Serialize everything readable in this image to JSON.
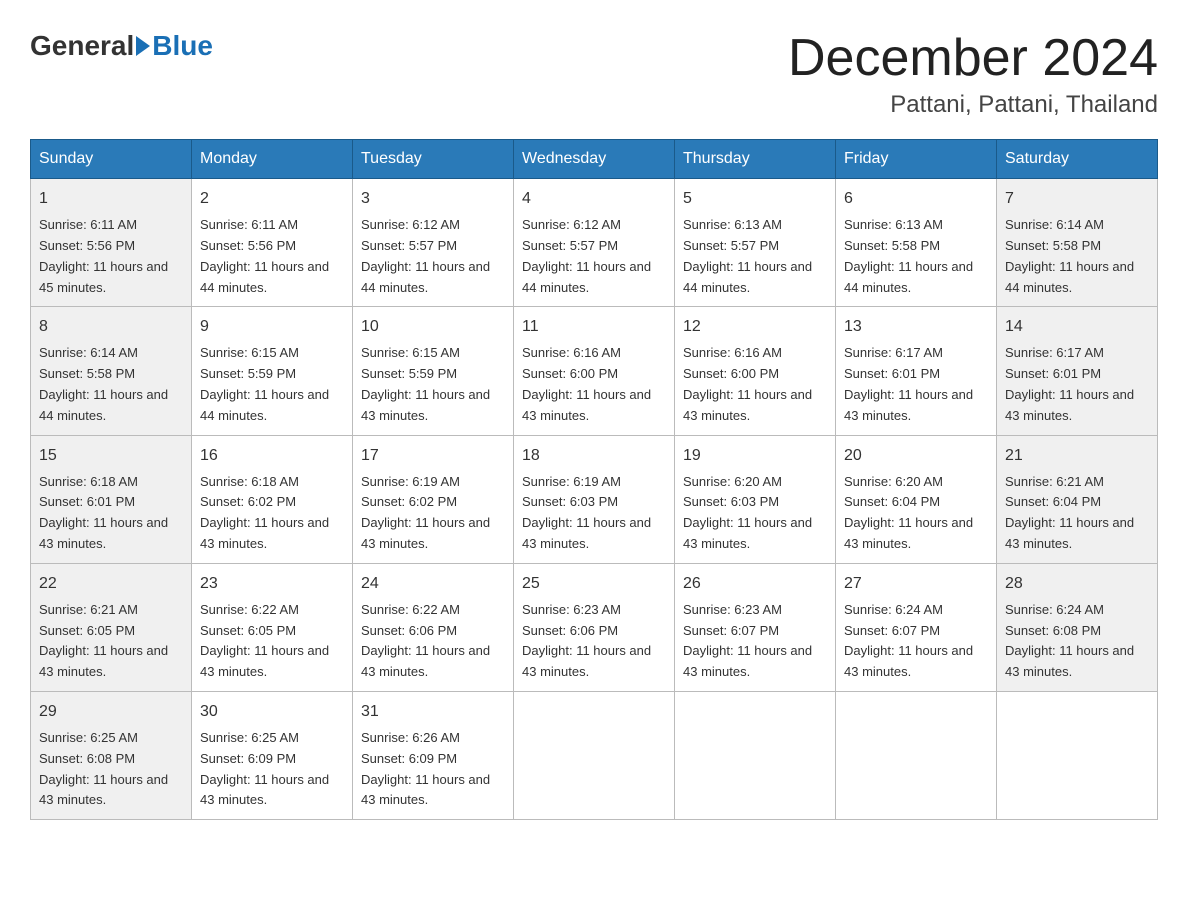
{
  "header": {
    "logo_general": "General",
    "logo_blue": "Blue",
    "month_title": "December 2024",
    "location": "Pattani, Pattani, Thailand"
  },
  "weekdays": [
    "Sunday",
    "Monday",
    "Tuesday",
    "Wednesday",
    "Thursday",
    "Friday",
    "Saturday"
  ],
  "weeks": [
    [
      {
        "day": "1",
        "sunrise": "6:11 AM",
        "sunset": "5:56 PM",
        "daylight": "11 hours and 45 minutes."
      },
      {
        "day": "2",
        "sunrise": "6:11 AM",
        "sunset": "5:56 PM",
        "daylight": "11 hours and 44 minutes."
      },
      {
        "day": "3",
        "sunrise": "6:12 AM",
        "sunset": "5:57 PM",
        "daylight": "11 hours and 44 minutes."
      },
      {
        "day": "4",
        "sunrise": "6:12 AM",
        "sunset": "5:57 PM",
        "daylight": "11 hours and 44 minutes."
      },
      {
        "day": "5",
        "sunrise": "6:13 AM",
        "sunset": "5:57 PM",
        "daylight": "11 hours and 44 minutes."
      },
      {
        "day": "6",
        "sunrise": "6:13 AM",
        "sunset": "5:58 PM",
        "daylight": "11 hours and 44 minutes."
      },
      {
        "day": "7",
        "sunrise": "6:14 AM",
        "sunset": "5:58 PM",
        "daylight": "11 hours and 44 minutes."
      }
    ],
    [
      {
        "day": "8",
        "sunrise": "6:14 AM",
        "sunset": "5:58 PM",
        "daylight": "11 hours and 44 minutes."
      },
      {
        "day": "9",
        "sunrise": "6:15 AM",
        "sunset": "5:59 PM",
        "daylight": "11 hours and 44 minutes."
      },
      {
        "day": "10",
        "sunrise": "6:15 AM",
        "sunset": "5:59 PM",
        "daylight": "11 hours and 43 minutes."
      },
      {
        "day": "11",
        "sunrise": "6:16 AM",
        "sunset": "6:00 PM",
        "daylight": "11 hours and 43 minutes."
      },
      {
        "day": "12",
        "sunrise": "6:16 AM",
        "sunset": "6:00 PM",
        "daylight": "11 hours and 43 minutes."
      },
      {
        "day": "13",
        "sunrise": "6:17 AM",
        "sunset": "6:01 PM",
        "daylight": "11 hours and 43 minutes."
      },
      {
        "day": "14",
        "sunrise": "6:17 AM",
        "sunset": "6:01 PM",
        "daylight": "11 hours and 43 minutes."
      }
    ],
    [
      {
        "day": "15",
        "sunrise": "6:18 AM",
        "sunset": "6:01 PM",
        "daylight": "11 hours and 43 minutes."
      },
      {
        "day": "16",
        "sunrise": "6:18 AM",
        "sunset": "6:02 PM",
        "daylight": "11 hours and 43 minutes."
      },
      {
        "day": "17",
        "sunrise": "6:19 AM",
        "sunset": "6:02 PM",
        "daylight": "11 hours and 43 minutes."
      },
      {
        "day": "18",
        "sunrise": "6:19 AM",
        "sunset": "6:03 PM",
        "daylight": "11 hours and 43 minutes."
      },
      {
        "day": "19",
        "sunrise": "6:20 AM",
        "sunset": "6:03 PM",
        "daylight": "11 hours and 43 minutes."
      },
      {
        "day": "20",
        "sunrise": "6:20 AM",
        "sunset": "6:04 PM",
        "daylight": "11 hours and 43 minutes."
      },
      {
        "day": "21",
        "sunrise": "6:21 AM",
        "sunset": "6:04 PM",
        "daylight": "11 hours and 43 minutes."
      }
    ],
    [
      {
        "day": "22",
        "sunrise": "6:21 AM",
        "sunset": "6:05 PM",
        "daylight": "11 hours and 43 minutes."
      },
      {
        "day": "23",
        "sunrise": "6:22 AM",
        "sunset": "6:05 PM",
        "daylight": "11 hours and 43 minutes."
      },
      {
        "day": "24",
        "sunrise": "6:22 AM",
        "sunset": "6:06 PM",
        "daylight": "11 hours and 43 minutes."
      },
      {
        "day": "25",
        "sunrise": "6:23 AM",
        "sunset": "6:06 PM",
        "daylight": "11 hours and 43 minutes."
      },
      {
        "day": "26",
        "sunrise": "6:23 AM",
        "sunset": "6:07 PM",
        "daylight": "11 hours and 43 minutes."
      },
      {
        "day": "27",
        "sunrise": "6:24 AM",
        "sunset": "6:07 PM",
        "daylight": "11 hours and 43 minutes."
      },
      {
        "day": "28",
        "sunrise": "6:24 AM",
        "sunset": "6:08 PM",
        "daylight": "11 hours and 43 minutes."
      }
    ],
    [
      {
        "day": "29",
        "sunrise": "6:25 AM",
        "sunset": "6:08 PM",
        "daylight": "11 hours and 43 minutes."
      },
      {
        "day": "30",
        "sunrise": "6:25 AM",
        "sunset": "6:09 PM",
        "daylight": "11 hours and 43 minutes."
      },
      {
        "day": "31",
        "sunrise": "6:26 AM",
        "sunset": "6:09 PM",
        "daylight": "11 hours and 43 minutes."
      },
      null,
      null,
      null,
      null
    ]
  ]
}
